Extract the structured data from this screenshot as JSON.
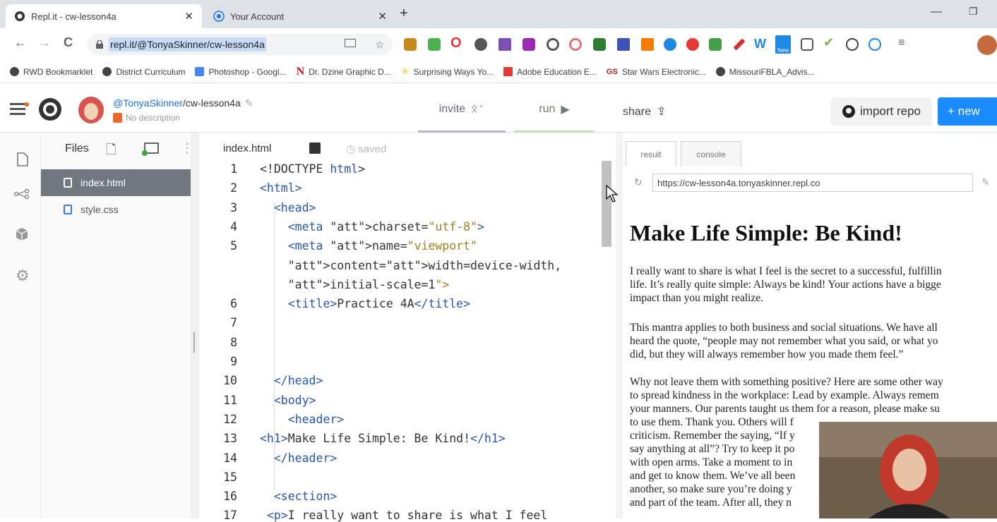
{
  "browser": {
    "tabs": [
      {
        "title": "Repl.it - cw-lesson4a",
        "close": "✕"
      },
      {
        "title": "Your Account",
        "close": "✕"
      }
    ],
    "new_tab": "+",
    "window_controls": {
      "minimize": "—",
      "maximize": "❐"
    },
    "nav": {
      "back": "←",
      "forward": "→",
      "reload": "C"
    },
    "url": "repl.it/@TonyaSkinner/cw-lesson4a",
    "extension_badges": {
      "new": "New"
    },
    "bookmarks": [
      "RWD Bookmarklet",
      "District Curriculum",
      "Photoshop - Googl...",
      "Dr. Dzine Graphic D...",
      "Surprising Ways Yo...",
      "Adobe Education E...",
      "Star Wars Electronic...",
      "MissouriFBLA_Advis..."
    ],
    "bookmark_icon_text": {
      "n": "N",
      "gs": "GS"
    }
  },
  "repl": {
    "user": "@TonyaSkinner",
    "project_suffix": "/cw-lesson4a",
    "description": "No description",
    "invite": "invite",
    "run": "run",
    "share": "share",
    "import_repo": "import repo",
    "new_repl": "+ new"
  },
  "files": {
    "header": "Files",
    "items": [
      {
        "name": "index.html",
        "active": true
      },
      {
        "name": "style.css",
        "active": false
      }
    ]
  },
  "editor": {
    "tab": "index.html",
    "status": "saved",
    "lines": [
      {
        "n": "1",
        "text": "<!DOCTYPE html>"
      },
      {
        "n": "2",
        "text": "<html>"
      },
      {
        "n": "3",
        "text": "  <head>"
      },
      {
        "n": "4",
        "text": "    <meta charset=\"utf-8\">"
      },
      {
        "n": "5",
        "text": "    <meta name=\"viewport\""
      },
      {
        "n": "",
        "text": "    content=\"width=device-width,"
      },
      {
        "n": "",
        "text": "    initial-scale=1\">"
      },
      {
        "n": "6",
        "text": "    <title>Practice 4A</title>"
      },
      {
        "n": "7",
        "text": ""
      },
      {
        "n": "8",
        "text": ""
      },
      {
        "n": "9",
        "text": ""
      },
      {
        "n": "10",
        "text": "  </head>"
      },
      {
        "n": "11",
        "text": "  <body>"
      },
      {
        "n": "12",
        "text": "    <header>"
      },
      {
        "n": "13",
        "text": "<h1>Make Life Simple: Be Kind!</h1>"
      },
      {
        "n": "14",
        "text": "  </header>"
      },
      {
        "n": "15",
        "text": ""
      },
      {
        "n": "16",
        "text": "  <section>"
      },
      {
        "n": "17",
        "text": " <p>I really want to share is what I feel"
      }
    ]
  },
  "result": {
    "tabs": [
      "result",
      "console"
    ],
    "url": "https://cw-lesson4a.tonyaskinner.repl.co",
    "heading": "Make Life Simple: Be Kind!",
    "paragraphs": [
      [
        "I really want to share is what I feel is the secret to a successful, fulfillin",
        "life. It’s really quite simple: Always be kind! Your actions have a bigge",
        "impact than you might realize."
      ],
      [
        "This mantra applies to both business and social situations. We have all",
        "heard the quote, “people may not remember what you said, or what yo",
        "did, but they will always remember how you made them feel.”"
      ],
      [
        "Why not leave them with something positive? Here are some other way",
        "to spread kindness in the workplace: Lead by example. Always remem",
        "your manners. Our parents taught us them for a reason, please make su",
        "to use them. Thank you. Others will f",
        "criticism. Remember the saying, “If y",
        "say anything at all”? Try to keep it po",
        "with open arms. Take a moment to in",
        "and get to know them. We’ve all been",
        "another, so make sure you’re doing y",
        "and part of the team. After all, they n"
      ]
    ]
  },
  "colors": {
    "accent": "#1a8cff",
    "tag": "#2956b2",
    "attr": "#a0427d",
    "string": "#a67f1c",
    "active_file": "#737880"
  }
}
